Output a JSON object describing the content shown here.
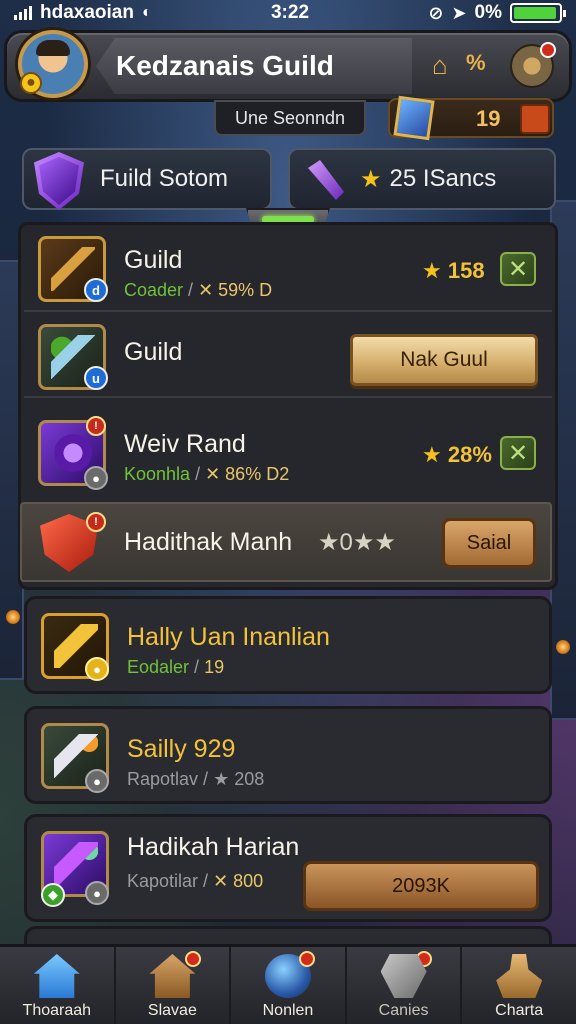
{
  "status_bar": {
    "carrier": "hdaxaoian",
    "time": "3:22",
    "battery_pct": "0%",
    "battery_level": 0.95
  },
  "header": {
    "title": "Kedzanais Guild",
    "sub_label": "Une Seonndn",
    "resource_value": "19"
  },
  "tabs": [
    {
      "label": "Fuild Sotom"
    },
    {
      "label": "25 ISancs"
    }
  ],
  "list": [
    {
      "name": "Guild",
      "sub_left": "Coader",
      "sub_right": "59% D",
      "value": "158"
    },
    {
      "name": "Guild",
      "button": "Nak Guul"
    },
    {
      "name": "Weiv Rand",
      "sub_left": "Koonhla",
      "sub_right": "86% D2",
      "value": "28%"
    },
    {
      "name": "Hadithak Manh",
      "stars_text": "0",
      "button": "Saial"
    }
  ],
  "cards": [
    {
      "name": "Hally Uan Inanlian",
      "sub_left": "Eodaler",
      "sub_right": "19"
    },
    {
      "name": "Sailly 929",
      "sub_left": "Rapotlav",
      "sub_right": "208"
    },
    {
      "name": "Hadikah Harian",
      "sub_left": "Kapotilar",
      "sub_right": "800",
      "button": "2093K"
    }
  ],
  "nav": [
    {
      "label": "Thoaraah",
      "icon": "home-icon"
    },
    {
      "label": "Slavae",
      "icon": "house-icon"
    },
    {
      "label": "Nonlen",
      "icon": "orb-icon"
    },
    {
      "label": "Canies",
      "icon": "tools-icon"
    },
    {
      "label": "Charta",
      "icon": "person-icon"
    }
  ],
  "colors": {
    "accent_gold": "#f2c33a",
    "sub_green": "#6fc23a",
    "badge_red": "#d42a1a"
  }
}
